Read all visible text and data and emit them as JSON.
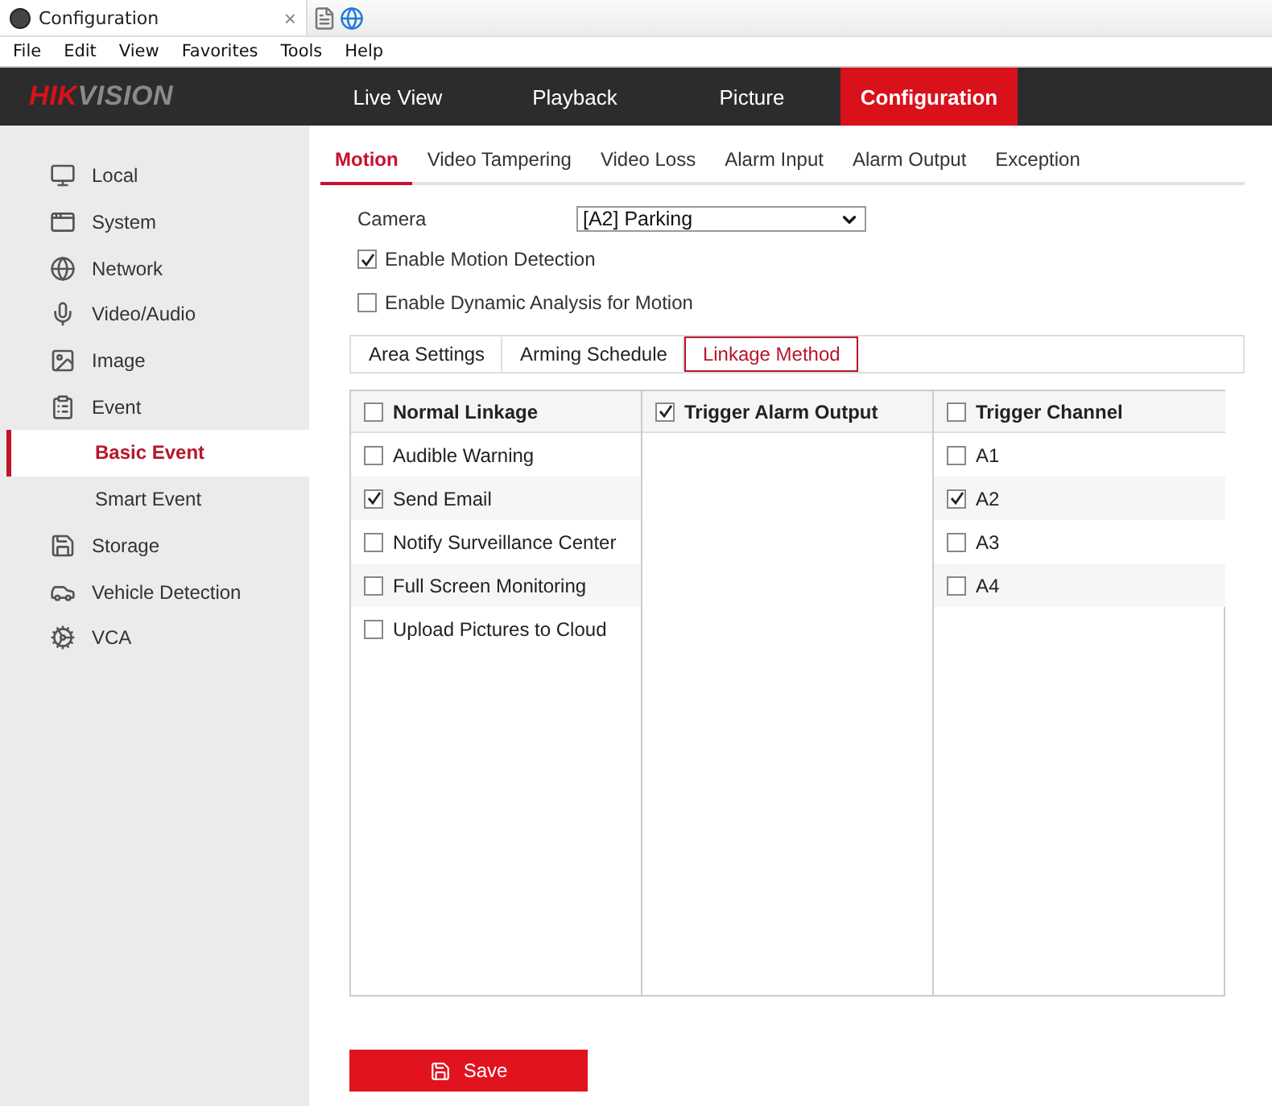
{
  "browser_tab": {
    "title": "Configuration",
    "close": "×"
  },
  "menu_bar": [
    "File",
    "Edit",
    "View",
    "Favorites",
    "Tools",
    "Help"
  ],
  "logo": [
    "HIK",
    "VISION"
  ],
  "nav_tabs": [
    {
      "label": "Live View",
      "selected": false
    },
    {
      "label": "Playback",
      "selected": false
    },
    {
      "label": "Picture",
      "selected": false
    },
    {
      "label": "Configuration",
      "selected": true
    }
  ],
  "sidebar": {
    "items": [
      {
        "label": "Local",
        "selected": false
      },
      {
        "label": "System",
        "selected": false
      },
      {
        "label": "Network",
        "selected": false
      },
      {
        "label": "Video/Audio",
        "selected": false
      },
      {
        "label": "Image",
        "selected": false
      },
      {
        "label": "Event",
        "selected": false,
        "children": [
          {
            "label": "Basic Event",
            "selected": true
          },
          {
            "label": "Smart Event",
            "selected": false
          }
        ]
      },
      {
        "label": "Storage",
        "selected": false
      },
      {
        "label": "Vehicle Detection",
        "selected": false
      },
      {
        "label": "VCA",
        "selected": false
      }
    ]
  },
  "sub_tabs": [
    {
      "label": "Motion",
      "selected": true
    },
    {
      "label": "Video Tampering",
      "selected": false
    },
    {
      "label": "Video Loss",
      "selected": false
    },
    {
      "label": "Alarm Input",
      "selected": false
    },
    {
      "label": "Alarm Output",
      "selected": false
    },
    {
      "label": "Exception",
      "selected": false
    }
  ],
  "camera": {
    "label": "Camera",
    "value": "[A2] Parking"
  },
  "options": [
    {
      "label": "Enable Motion Detection",
      "checked": true
    },
    {
      "label": "Enable Dynamic Analysis for Motion",
      "checked": false
    }
  ],
  "steps": [
    {
      "label": "Area Settings",
      "selected": false
    },
    {
      "label": "Arming Schedule",
      "selected": false
    },
    {
      "label": "Linkage Method",
      "selected": true
    }
  ],
  "linkage_table": {
    "columns": [
      {
        "title": "Normal Linkage",
        "checked": false,
        "items": [
          {
            "label": "Audible Warning",
            "checked": false
          },
          {
            "label": "Send Email",
            "checked": true
          },
          {
            "label": "Notify Surveillance Center",
            "checked": false
          },
          {
            "label": "Full Screen Monitoring",
            "checked": false
          },
          {
            "label": "Upload Pictures to Cloud",
            "checked": false
          }
        ]
      },
      {
        "title": "Trigger Alarm Output",
        "checked": true
      },
      {
        "title": "Trigger Channel",
        "checked": false,
        "items": [
          {
            "label": "A1",
            "checked": false
          },
          {
            "label": "A2",
            "checked": true
          },
          {
            "label": "A3",
            "checked": false
          },
          {
            "label": "A4",
            "checked": false
          }
        ]
      }
    ]
  },
  "save_button": "Save"
}
